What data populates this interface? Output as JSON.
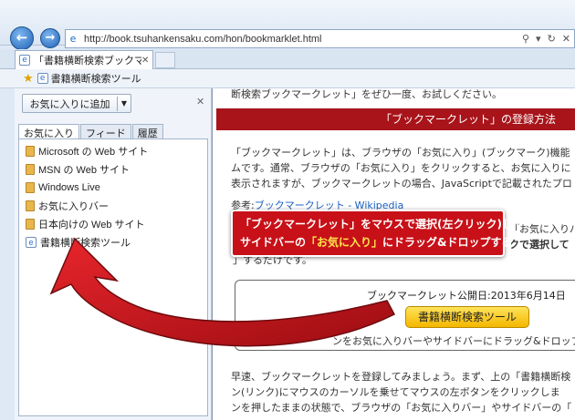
{
  "browser": {
    "url": "http://book.tsuhankensaku.com/hon/bookmarklet.html",
    "tab_title": "「書籍横断検索ブックマ...",
    "favbar_item": "書籍横断検索ツール"
  },
  "sidebar": {
    "add_button": "お気に入りに追加",
    "tabs": [
      "お気に入り",
      "フィード",
      "履歴"
    ],
    "items": [
      {
        "label": "Microsoft の Web サイト",
        "icon": "folder-icon"
      },
      {
        "label": "MSN の Web サイト",
        "icon": "folder-icon"
      },
      {
        "label": "Windows Live",
        "icon": "folder-icon"
      },
      {
        "label": "お気に入りバー",
        "icon": "folder-icon"
      },
      {
        "label": "日本向けの Web サイト",
        "icon": "folder-icon"
      },
      {
        "label": "書籍横断検索ツール",
        "icon": "ie-page-icon"
      }
    ]
  },
  "content": {
    "intro": "断検索ブックマークレット」をぜひ一度、お試しください。",
    "section_title": "「ブックマークレット」の登録方法",
    "para1": [
      "「ブックマークレット」は、ブラウザの「お気に入り」(ブックマーク)機能",
      "ムです。通常、ブラウザの「お気に入り」をクリックすると、お気に入りに",
      "表示されますが、ブックマークレットの場合、JavaScriptで記載されたプロ"
    ],
    "ref_label": "参考:",
    "ref_link": "ブックマークレット - Wikipedia",
    "side_text_1": "「お気に入りバ",
    "side_text_2": "クで選択して",
    "side_text_3": "」するだけです。",
    "box_date": "ブックマークレット公開日:2013年6月14日",
    "bookmarklet_button": "書籍横断検索ツール",
    "box_hint": "ンをお気に入りバーやサイドバーにドラッグ&ドロップ",
    "para2": [
      "早速、ブックマークレットを登録してみましょう。まず、上の「書籍横断検",
      "ン(リンク)にマウスのカーソルを乗せてマウスの左ボタンをクリックしま",
      "ンを押したままの状態で、ブラウザの「お気に入りバー」やサイドバーの「"
    ]
  },
  "callout": {
    "line1": "「ブックマークレット」をマウスで選択(左クリック)して",
    "line2_a": "サイドバーの",
    "line2_b": "「お気に入り」",
    "line2_c": "にドラッグ&ドロップする"
  },
  "colors": {
    "accent_red": "#c81018",
    "section_red": "#a8141a",
    "button_yellow": "#f4b700"
  }
}
